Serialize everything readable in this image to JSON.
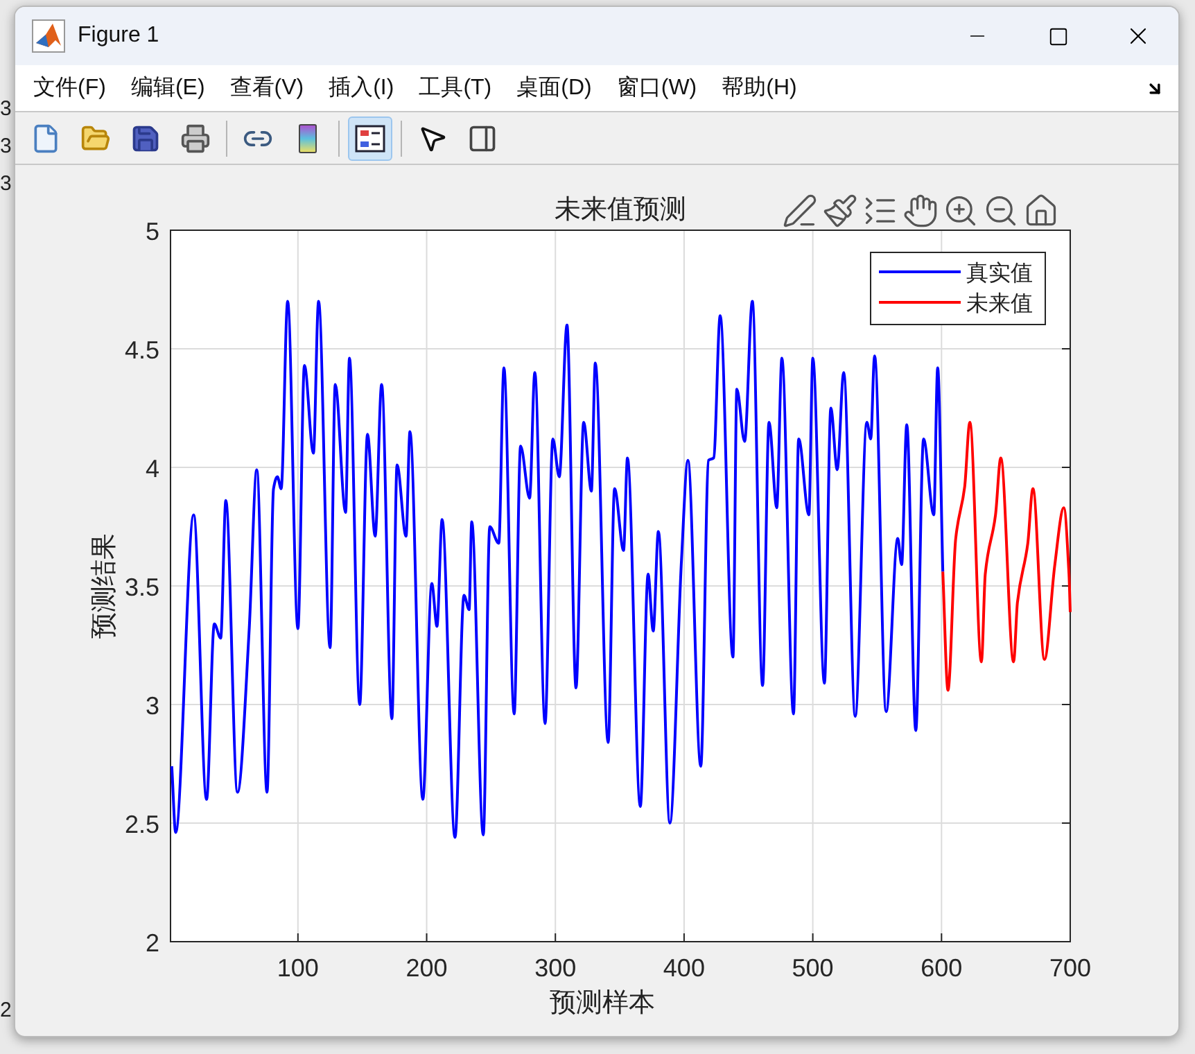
{
  "background_fragments": [
    "3",
    "3",
    "3",
    "2"
  ],
  "window": {
    "title": "Figure 1"
  },
  "menu": [
    "文件(F)",
    "编辑(E)",
    "查看(V)",
    "插入(I)",
    "工具(T)",
    "桌面(D)",
    "窗口(W)",
    "帮助(H)"
  ],
  "toolbar": [
    {
      "kind": "new",
      "selected": false
    },
    {
      "kind": "open",
      "selected": false
    },
    {
      "kind": "save",
      "selected": false
    },
    {
      "kind": "print",
      "selected": false
    },
    {
      "kind": "link",
      "selected": false
    },
    {
      "kind": "colorbar",
      "selected": false
    },
    {
      "kind": "legend",
      "selected": true
    },
    {
      "kind": "pointer",
      "selected": false
    },
    {
      "kind": "property",
      "selected": false
    }
  ],
  "plot": {
    "chart_data": {
      "type": "line",
      "title": "未来值预测",
      "xlabel": "预测样本",
      "ylabel": "预测结果",
      "xlim": [
        1,
        700
      ],
      "ylim": [
        2,
        5
      ],
      "xticks": [
        100,
        200,
        300,
        400,
        500,
        600,
        700
      ],
      "yticks": [
        2,
        2.5,
        3,
        3.5,
        4,
        4.5,
        5
      ],
      "grid": true,
      "legend": true,
      "series": [
        {
          "name": "真实值",
          "color": "#0000ff",
          "x": [
            2,
            5,
            19,
            29,
            35,
            40,
            44,
            53,
            62,
            68,
            76,
            81,
            84,
            87,
            92,
            100,
            105,
            112,
            116,
            125,
            129,
            137,
            140,
            148,
            154,
            160,
            165,
            173,
            177,
            184,
            187,
            197,
            204,
            208,
            212,
            222,
            229,
            233,
            235,
            244,
            249,
            256,
            260,
            268,
            273,
            280,
            284,
            292,
            298,
            303,
            309,
            316,
            322,
            328,
            331,
            341,
            346,
            353,
            356,
            366,
            372,
            376,
            380,
            389,
            398,
            403,
            413,
            419,
            423,
            428,
            438,
            441,
            447,
            453,
            461,
            466,
            472,
            476,
            485,
            489,
            497,
            500,
            509,
            514,
            519,
            524,
            533,
            542,
            545,
            548,
            557,
            566,
            569,
            573,
            580,
            586,
            594,
            597,
            601
          ],
          "values": [
            2.74,
            2.46,
            3.8,
            2.6,
            3.34,
            3.28,
            3.86,
            2.63,
            3.3,
            3.99,
            2.63,
            3.91,
            3.96,
            3.91,
            4.7,
            3.32,
            4.43,
            4.06,
            4.7,
            3.24,
            4.35,
            3.81,
            4.46,
            3.0,
            4.14,
            3.71,
            4.35,
            2.94,
            4.01,
            3.71,
            4.15,
            2.6,
            3.51,
            3.33,
            3.78,
            2.44,
            3.46,
            3.4,
            3.77,
            2.45,
            3.75,
            3.68,
            4.42,
            2.96,
            4.09,
            3.87,
            4.4,
            2.92,
            4.12,
            3.96,
            4.6,
            3.07,
            4.19,
            3.9,
            4.44,
            2.84,
            3.91,
            3.65,
            4.04,
            2.57,
            3.55,
            3.31,
            3.73,
            2.5,
            3.61,
            4.03,
            2.74,
            4.03,
            4.04,
            4.64,
            3.2,
            4.33,
            4.11,
            4.7,
            3.08,
            4.19,
            3.83,
            4.46,
            2.96,
            4.12,
            3.8,
            4.46,
            3.09,
            4.25,
            3.99,
            4.4,
            2.95,
            4.19,
            4.12,
            4.47,
            2.97,
            3.7,
            3.59,
            4.18,
            2.89,
            4.12,
            3.8,
            4.42,
            3.56
          ]
        },
        {
          "name": "未来值",
          "color": "#ff0000",
          "x": [
            601,
            605,
            611,
            618,
            622,
            631,
            634,
            642,
            646,
            656,
            659,
            667,
            671,
            680,
            688,
            695,
            699,
            700
          ],
          "values": [
            3.56,
            3.06,
            3.7,
            3.92,
            4.19,
            3.18,
            3.55,
            3.8,
            4.04,
            3.18,
            3.43,
            3.68,
            3.91,
            3.19,
            3.59,
            3.83,
            3.55,
            3.39
          ]
        }
      ]
    }
  }
}
